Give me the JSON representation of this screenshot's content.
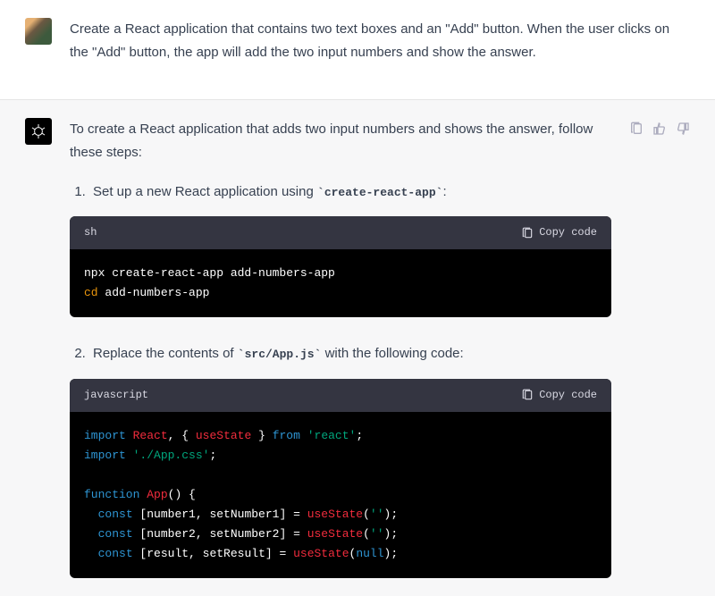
{
  "user": {
    "text": "Create a React application that contains two text boxes and an \"Add\" button. When the user clicks on the \"Add\" button, the app will add the two input numbers and show the answer."
  },
  "assistant": {
    "intro": "To create a React application that adds two input numbers and shows the answer, follow these steps:",
    "step1_pre": "Set up a new React application using ",
    "step1_code": "create-react-app",
    "step1_post": ":",
    "step2_pre": "Replace the contents of ",
    "step2_code": "src/App.js",
    "step2_post": " with the following code:",
    "codeblock1": {
      "lang": "sh",
      "copy": "Copy code",
      "line1_cmd": "npx create-react-app add-numbers-app",
      "line2_cmd": "cd",
      "line2_arg": " add-numbers-app"
    },
    "codeblock2": {
      "lang": "javascript",
      "copy": "Copy code",
      "t_import": "import",
      "t_React": "React",
      "t_comma_brace": ", { ",
      "t_useState": "useState",
      "t_brace_from": " } ",
      "t_from": "from",
      "t_react_str": "'react'",
      "t_semi": ";",
      "t_appcss": "'./App.css'",
      "t_function": "function",
      "t_App": "App",
      "t_parens_brace": "() {",
      "t_const": "const",
      "t_n1": "number1",
      "t_sn1": "setNumber1",
      "t_eq": " = ",
      "t_empty": "''",
      "t_n2": "number2",
      "t_sn2": "setNumber2",
      "t_res": "result",
      "t_sres": "setResult",
      "t_null": "null"
    }
  }
}
